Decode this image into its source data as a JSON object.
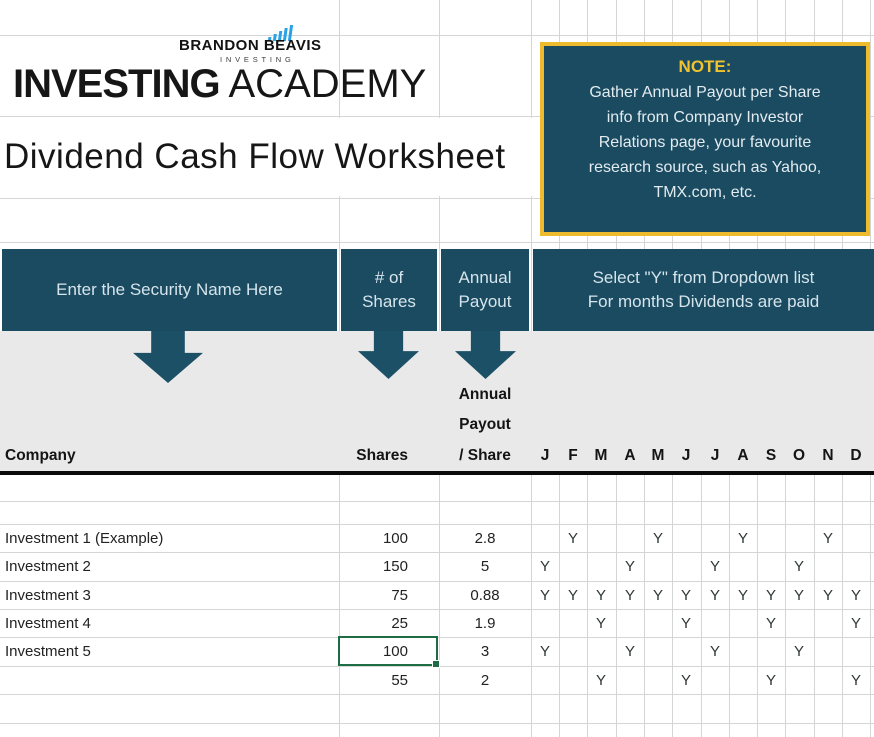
{
  "logo": {
    "brand_top": "BRANDON BEAVIS",
    "brand_sub": "INVESTING",
    "title_bold": "INVESTING",
    "title_light": "ACADEMY"
  },
  "page_title": "Dividend Cash Flow Worksheet",
  "note": {
    "title": "NOTE:",
    "lines": [
      "Gather Annual Payout per Share",
      "info from Company Investor",
      "Relations page, your favourite",
      "research source, such as Yahoo,",
      "TMX.com, etc."
    ]
  },
  "instructions": {
    "security_name": "Enter the Security Name Here",
    "shares_line1": "# of",
    "shares_line2": "Shares",
    "payout_line1": "Annual",
    "payout_line2": "Payout",
    "dropdown_line1": "Select \"Y\" from Dropdown list",
    "dropdown_line2": "For months Dividends are paid"
  },
  "table": {
    "header": {
      "company": "Company",
      "shares": "Shares",
      "payout_line1": "Annual",
      "payout_line2": "Payout",
      "payout_line3": "/ Share",
      "months": [
        "J",
        "F",
        "M",
        "A",
        "M",
        "J",
        "J",
        "A",
        "S",
        "O",
        "N",
        "D"
      ]
    },
    "rows": [
      {
        "company": "Investment 1 (Example)",
        "shares": "100",
        "payout": "2.8",
        "flags": [
          "",
          "Y",
          "",
          "",
          "Y",
          "",
          "",
          "Y",
          "",
          "",
          "Y",
          ""
        ]
      },
      {
        "company": "Investment 2",
        "shares": "150",
        "payout": "5",
        "flags": [
          "Y",
          "",
          "",
          "Y",
          "",
          "",
          "Y",
          "",
          "",
          "Y",
          "",
          ""
        ]
      },
      {
        "company": "Investment 3",
        "shares": "75",
        "payout": "0.88",
        "flags": [
          "Y",
          "Y",
          "Y",
          "Y",
          "Y",
          "Y",
          "Y",
          "Y",
          "Y",
          "Y",
          "Y",
          "Y"
        ]
      },
      {
        "company": "Investment 4",
        "shares": "25",
        "payout": "1.9",
        "flags": [
          "",
          "",
          "Y",
          "",
          "",
          "Y",
          "",
          "",
          "Y",
          "",
          "",
          "Y"
        ]
      },
      {
        "company": "Investment 5",
        "shares": "100",
        "payout": "3",
        "flags": [
          "Y",
          "",
          "",
          "Y",
          "",
          "",
          "Y",
          "",
          "",
          "Y",
          "",
          ""
        ]
      },
      {
        "company": "",
        "shares": "55",
        "payout": "2",
        "flags": [
          "",
          "",
          "Y",
          "",
          "",
          "Y",
          "",
          "",
          "Y",
          "",
          "",
          "Y"
        ]
      }
    ]
  },
  "active_cell": {
    "company": "Investment 5",
    "column": "Shares",
    "value": "100"
  },
  "colors": {
    "teal": "#1a4b60",
    "gold_border": "#edbb2d",
    "note_title": "#f0c32f",
    "gray_band": "#e9e9e9",
    "gridline": "#d4d6d6",
    "selection_green": "#1e6c43",
    "logo_blue": "#2aa2e8"
  }
}
